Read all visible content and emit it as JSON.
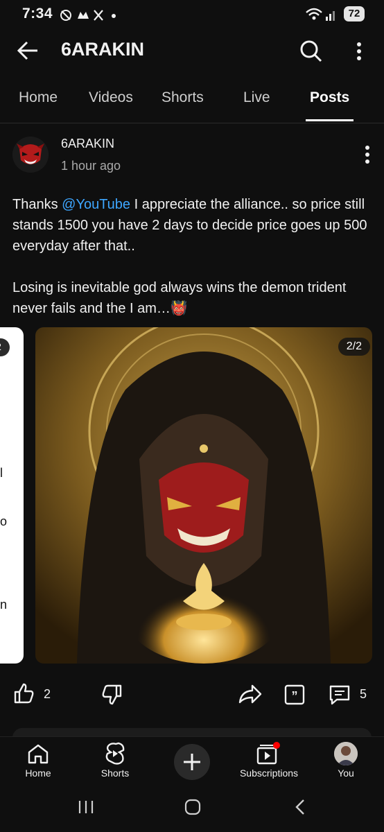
{
  "status_bar": {
    "time": "7:34",
    "battery": "72"
  },
  "header": {
    "title": "6ARAKIN"
  },
  "tabs": [
    {
      "label": "Home"
    },
    {
      "label": "Videos"
    },
    {
      "label": "Shorts"
    },
    {
      "label": "Live"
    },
    {
      "label": "Posts"
    }
  ],
  "post": {
    "channel": "6ARAKIN",
    "time": "1 hour ago",
    "text_before_mention": "Thanks ",
    "mention": "@YouTube",
    "text_after_mention": " I appreciate the alliance.. so price still stands 1500 you have 2 days to decide price goes up 500 everyday after that..",
    "paragraph2": "Losing is inevitable god always wins the demon trident never fails and the I am…",
    "emoji": "👹",
    "image_counter": "2/2",
    "prev_card_badge": "2",
    "prev_card_letters": [
      "l",
      "o",
      "n"
    ],
    "likes": "2",
    "comments": "5"
  },
  "bottom_nav": [
    {
      "label": "Home",
      "icon": "home-icon"
    },
    {
      "label": "Shorts",
      "icon": "shorts-icon"
    },
    {
      "label": "",
      "icon": "create-plus-icon"
    },
    {
      "label": "Subscriptions",
      "icon": "subscriptions-icon"
    },
    {
      "label": "You",
      "icon": "profile-avatar"
    }
  ],
  "colors": {
    "background": "#0f0f0f",
    "mention": "#3ea6ff",
    "notification_dot": "#ff0000"
  }
}
